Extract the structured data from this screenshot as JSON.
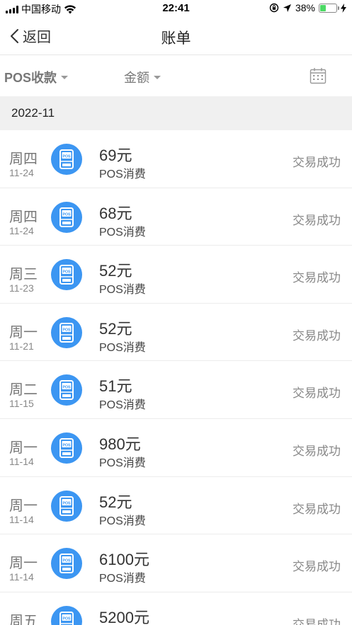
{
  "status_bar": {
    "carrier": "中国移动",
    "time": "22:41",
    "battery_percent": "38%",
    "battery_level": 0.38,
    "battery_color": "#4cd964"
  },
  "nav": {
    "back_label": "返回",
    "title": "账单"
  },
  "filters": {
    "type_label": "POS收款",
    "amount_label": "金额"
  },
  "month": "2022-11",
  "icon_colors": {
    "pos_start": "#8fc4ff",
    "pos_end": "#3c96f2"
  },
  "transactions": [
    {
      "weekday": "周四",
      "date": "11-24",
      "amount": "69元",
      "type": "POS消费",
      "status": "交易成功"
    },
    {
      "weekday": "周四",
      "date": "11-24",
      "amount": "68元",
      "type": "POS消费",
      "status": "交易成功"
    },
    {
      "weekday": "周三",
      "date": "11-23",
      "amount": "52元",
      "type": "POS消费",
      "status": "交易成功"
    },
    {
      "weekday": "周一",
      "date": "11-21",
      "amount": "52元",
      "type": "POS消费",
      "status": "交易成功"
    },
    {
      "weekday": "周二",
      "date": "11-15",
      "amount": "51元",
      "type": "POS消费",
      "status": "交易成功"
    },
    {
      "weekday": "周一",
      "date": "11-14",
      "amount": "980元",
      "type": "POS消费",
      "status": "交易成功"
    },
    {
      "weekday": "周一",
      "date": "11-14",
      "amount": "52元",
      "type": "POS消费",
      "status": "交易成功"
    },
    {
      "weekday": "周一",
      "date": "11-14",
      "amount": "6100元",
      "type": "POS消费",
      "status": "交易成功"
    },
    {
      "weekday": "周五",
      "date": "",
      "amount": "5200元",
      "type": "",
      "status": "交易成功"
    }
  ],
  "icons": {
    "back": "chevron-left-icon",
    "caret": "caret-down-icon",
    "calendar": "calendar-icon",
    "pos": "pos-terminal-icon",
    "wifi": "wifi-icon",
    "battery": "battery-icon"
  }
}
